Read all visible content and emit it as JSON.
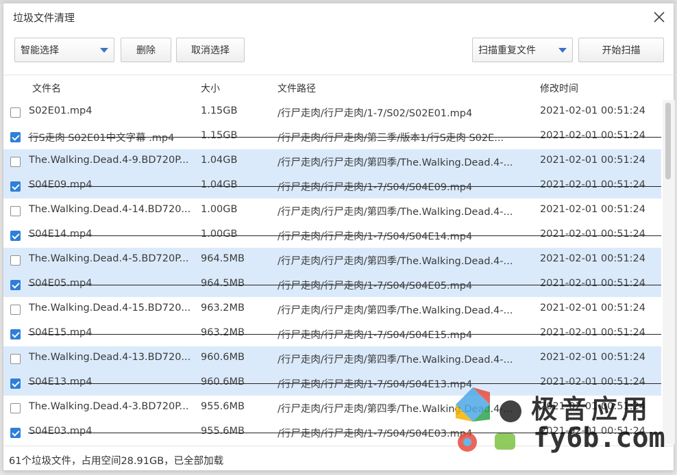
{
  "dialog": {
    "title": "垃圾文件清理"
  },
  "toolbar": {
    "smart_select": "智能选择",
    "delete_label": "删除",
    "deselect_label": "取消选择",
    "scan_mode": "扫描重复文件",
    "start_scan_label": "开始扫描"
  },
  "table": {
    "headers": {
      "name": "文件名",
      "size": "大小",
      "path": "文件路径",
      "modified": "修改时间"
    },
    "rows": [
      {
        "checked": false,
        "highlight": false,
        "name": "S02E01.mp4",
        "size": "1.15GB",
        "path": "/行尸走肉/行尸走肉/1-7/S02/S02E01.mp4",
        "modified": "2021-02-01 00:51:24"
      },
      {
        "checked": true,
        "highlight": false,
        "name": "行S走肉 S02E01中文字幕 .mp4",
        "size": "1.15GB",
        "path": "/行尸走肉/行尸走肉/第三季/版本1/行S走肉 S02E...",
        "modified": "2021-02-01 00:51:24"
      },
      {
        "checked": false,
        "highlight": true,
        "name": "The.Walking.Dead.4-9.BD720P...",
        "size": "1.04GB",
        "path": "/行尸走肉/行尸走肉/第四季/The.Walking.Dead.4-...",
        "modified": "2021-02-01 00:51:24"
      },
      {
        "checked": true,
        "highlight": true,
        "name": "S04E09.mp4",
        "size": "1.04GB",
        "path": "/行尸走肉/行尸走肉/1-7/S04/S04E09.mp4",
        "modified": "2021-02-01 00:51:24"
      },
      {
        "checked": false,
        "highlight": false,
        "name": "The.Walking.Dead.4-14.BD720...",
        "size": "1.00GB",
        "path": "/行尸走肉/行尸走肉/第四季/The.Walking.Dead.4-...",
        "modified": "2021-02-01 00:51:24"
      },
      {
        "checked": true,
        "highlight": false,
        "name": "S04E14.mp4",
        "size": "1.00GB",
        "path": "/行尸走肉/行尸走肉/1-7/S04/S04E14.mp4",
        "modified": "2021-02-01 00:51:24"
      },
      {
        "checked": false,
        "highlight": true,
        "name": "The.Walking.Dead.4-5.BD720P...",
        "size": "964.5MB",
        "path": "/行尸走肉/行尸走肉/第四季/The.Walking.Dead.4-...",
        "modified": "2021-02-01 00:51:24"
      },
      {
        "checked": true,
        "highlight": true,
        "name": "S04E05.mp4",
        "size": "964.5MB",
        "path": "/行尸走肉/行尸走肉/1-7/S04/S04E05.mp4",
        "modified": "2021-02-01 00:51:24"
      },
      {
        "checked": false,
        "highlight": false,
        "name": "The.Walking.Dead.4-15.BD720...",
        "size": "963.2MB",
        "path": "/行尸走肉/行尸走肉/第四季/The.Walking.Dead.4-...",
        "modified": "2021-02-01 00:51:24"
      },
      {
        "checked": true,
        "highlight": false,
        "name": "S04E15.mp4",
        "size": "963.2MB",
        "path": "/行尸走肉/行尸走肉/1-7/S04/S04E15.mp4",
        "modified": "2021-02-01 00:51:24"
      },
      {
        "checked": false,
        "highlight": true,
        "name": "The.Walking.Dead.4-13.BD720...",
        "size": "960.6MB",
        "path": "/行尸走肉/行尸走肉/第四季/The.Walking.Dead.4-...",
        "modified": "2021-02-01 00:51:24"
      },
      {
        "checked": true,
        "highlight": true,
        "name": "S04E13.mp4",
        "size": "960.6MB",
        "path": "/行尸走肉/行尸走肉/1-7/S04/S04E13.mp4",
        "modified": "2021-02-01 00:51:24"
      },
      {
        "checked": false,
        "highlight": false,
        "name": "The.Walking.Dead.4-3.BD720P...",
        "size": "955.6MB",
        "path": "/行尸走肉/行尸走肉/第四季/The.Walking.Dead.4-...",
        "modified": "2021-02-01 00:51:24"
      },
      {
        "checked": true,
        "highlight": false,
        "name": "S04E03.mp4",
        "size": "955.6MB",
        "path": "/行尸走肉/行尸走肉/1-7/S04/S04E03.mp4",
        "modified": "2021-02-01 00:51:24"
      }
    ]
  },
  "status": {
    "text": "61个垃圾文件，占用空间28.91GB，已全部加载"
  },
  "watermark": {
    "line1": "极音应用",
    "line2": "fy6b.com"
  },
  "colors": {
    "accent": "#2f7fd8",
    "row_highlight": "#dbeafb"
  }
}
